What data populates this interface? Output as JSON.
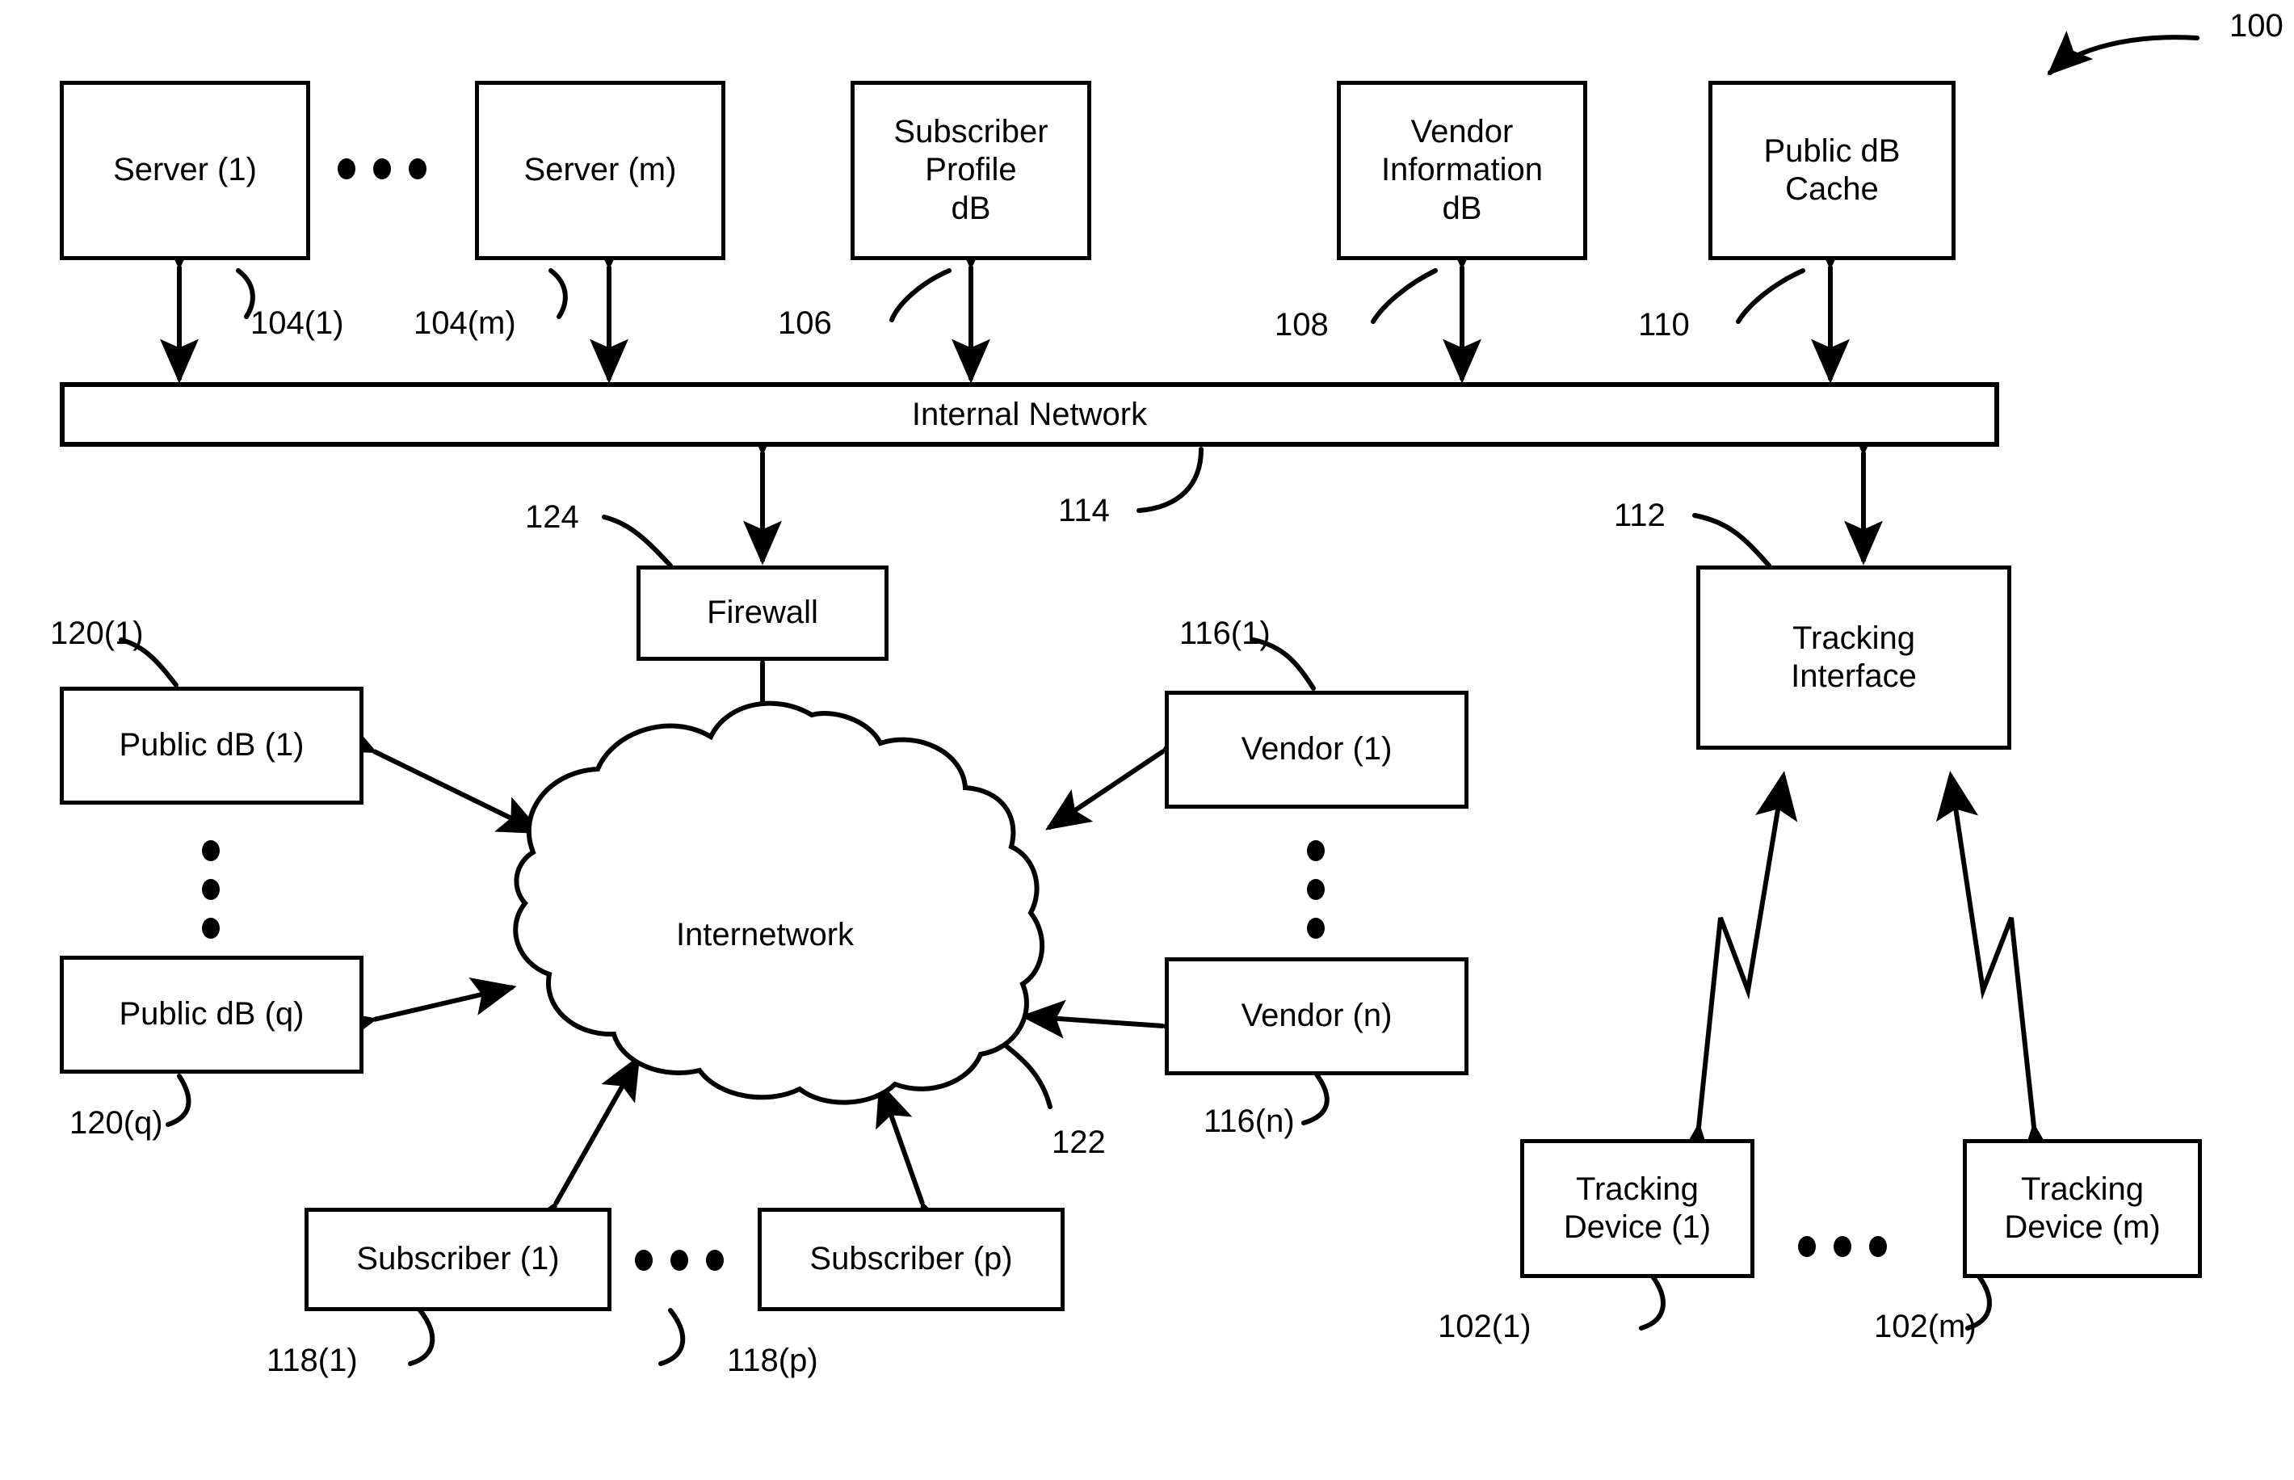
{
  "figure": {
    "reference_numeral": "100",
    "type": "patent-system-block-diagram"
  },
  "nodes": {
    "server_1": {
      "label": "Server (1)",
      "ref": "104(1)"
    },
    "server_m": {
      "label": "Server (m)",
      "ref": "104(m)"
    },
    "subscriber_profile_db": {
      "label": "Subscriber\nProfile\ndB",
      "ref": "106"
    },
    "vendor_information_db": {
      "label": "Vendor\nInformation\ndB",
      "ref": "108"
    },
    "public_db_cache": {
      "label": "Public dB\nCache",
      "ref": "110"
    },
    "internal_network": {
      "label": "Internal Network",
      "ref": "114"
    },
    "firewall": {
      "label": "Firewall",
      "ref": "124"
    },
    "tracking_interface": {
      "label": "Tracking\nInterface",
      "ref": "112"
    },
    "internetwork": {
      "label": "Internetwork",
      "ref": "122"
    },
    "public_db_1": {
      "label": "Public dB (1)",
      "ref": "120(1)"
    },
    "public_db_q": {
      "label": "Public dB (q)",
      "ref": "120(q)"
    },
    "vendor_1": {
      "label": "Vendor (1)",
      "ref": "116(1)"
    },
    "vendor_n": {
      "label": "Vendor (n)",
      "ref": "116(n)"
    },
    "subscriber_1": {
      "label": "Subscriber (1)",
      "ref": "118(1)"
    },
    "subscriber_p": {
      "label": "Subscriber (p)",
      "ref": "118(p)"
    },
    "tracking_device_1": {
      "label": "Tracking\nDevice (1)",
      "ref": "102(1)"
    },
    "tracking_device_m": {
      "label": "Tracking\nDevice (m)",
      "ref": "102(m)"
    }
  },
  "style": {
    "stroke": "#000000",
    "background": "#ffffff"
  }
}
